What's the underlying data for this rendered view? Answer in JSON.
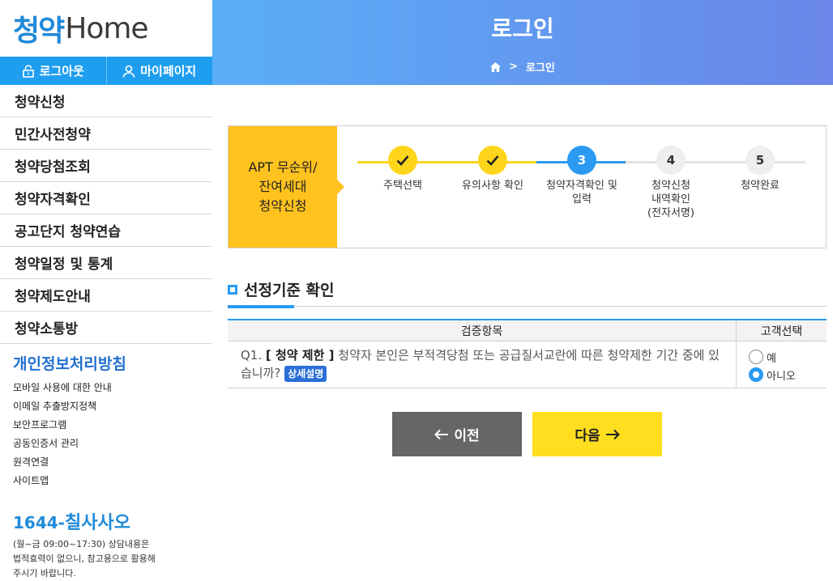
{
  "logo": {
    "korean": "청약",
    "english": "Home"
  },
  "topbar": {
    "logout": "로그아웃",
    "mypage": "마이페이지"
  },
  "menu": [
    "청약신청",
    "민간사전청약",
    "청약당첨조회",
    "청약자격확인",
    "공고단지 청약연습",
    "청약일정 및 통계",
    "청약제도안내",
    "청약소통방"
  ],
  "privacy": "개인정보처리방침",
  "links": [
    "모바일 사용에 대한 안내",
    "이메일 추출방지정책",
    "보안프로그램",
    "공동인증서 관리",
    "원격연결",
    "사이트맵"
  ],
  "phone": {
    "prefix": "1644-",
    "name": "칠사사오"
  },
  "phone_note": [
    "(월~금 09:00~17:30) 상담내용은",
    "법적효력이 없으니, 참고용으로 활용해",
    "주시기 바랍니다."
  ],
  "header": {
    "title": "로그인",
    "crumb": "로그인"
  },
  "steps_label": [
    "APT 무순위/",
    "잔여세대",
    "청약신청"
  ],
  "steps": [
    {
      "num": "",
      "label": [
        "주택선택"
      ],
      "state": "done"
    },
    {
      "num": "",
      "label": [
        "유의사항 확인"
      ],
      "state": "done"
    },
    {
      "num": "3",
      "label": [
        "청약자격확인 및",
        "입력"
      ],
      "state": "active"
    },
    {
      "num": "4",
      "label": [
        "청약신청",
        "내역확인",
        "(전자서명)"
      ],
      "state": "todo"
    },
    {
      "num": "5",
      "label": [
        "청약완료"
      ],
      "state": "todo"
    }
  ],
  "section_title": "선정기준 확인",
  "table": {
    "header": {
      "item": "검증항목",
      "choice": "고객선택"
    },
    "row": {
      "prefix": "Q1.",
      "tag": "[ 청약 제한 ]",
      "text": "청약자 본인은 부적격당첨 또는 공급질서교란에 따른 청약제한 기간 중에 있습니까?",
      "badge": "상세설명",
      "options": [
        "예",
        "아니오"
      ],
      "selected": "아니오"
    }
  },
  "buttons": {
    "prev": "이전",
    "next": "다음"
  },
  "colors": {
    "primary": "#2a9af2",
    "yellow": "#ffd51c",
    "step_label_bg": "#ffc21f"
  }
}
